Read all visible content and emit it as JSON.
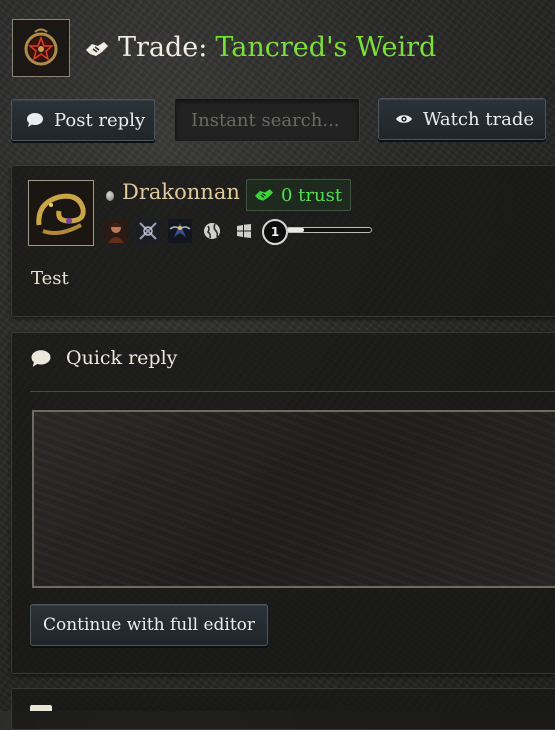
{
  "header": {
    "title_prefix": "Trade:",
    "title_name": "Tancred's Weird",
    "title_icon": "handshake-icon",
    "thread_icon": "pentagram-amulet-icon"
  },
  "toolbar": {
    "post_reply_label": "Post reply",
    "post_reply_icon": "speech-bubble-icon",
    "search_placeholder": "Instant search...",
    "watch_label": "Watch trade",
    "watch_icon": "eye-icon"
  },
  "post": {
    "username": "Drakonnan",
    "online_status": "offline",
    "trust_label": "0 trust",
    "trust_icon": "handshake-icon",
    "badges": [
      "character-portrait-icon",
      "crossed-swords-icon",
      "angel-emblem-icon",
      "globe-icon",
      "windows-icon"
    ],
    "level": "1",
    "level_progress": 0.2,
    "body": "Test"
  },
  "quick_reply": {
    "title": "Quick reply",
    "icon": "speech-bubble-icon",
    "editor_value": "",
    "full_editor_label": "Continue with full editor"
  },
  "colors": {
    "accent_green": "#7be03a",
    "trust_green": "#4ee04e",
    "username_gold": "#e3c99a"
  }
}
